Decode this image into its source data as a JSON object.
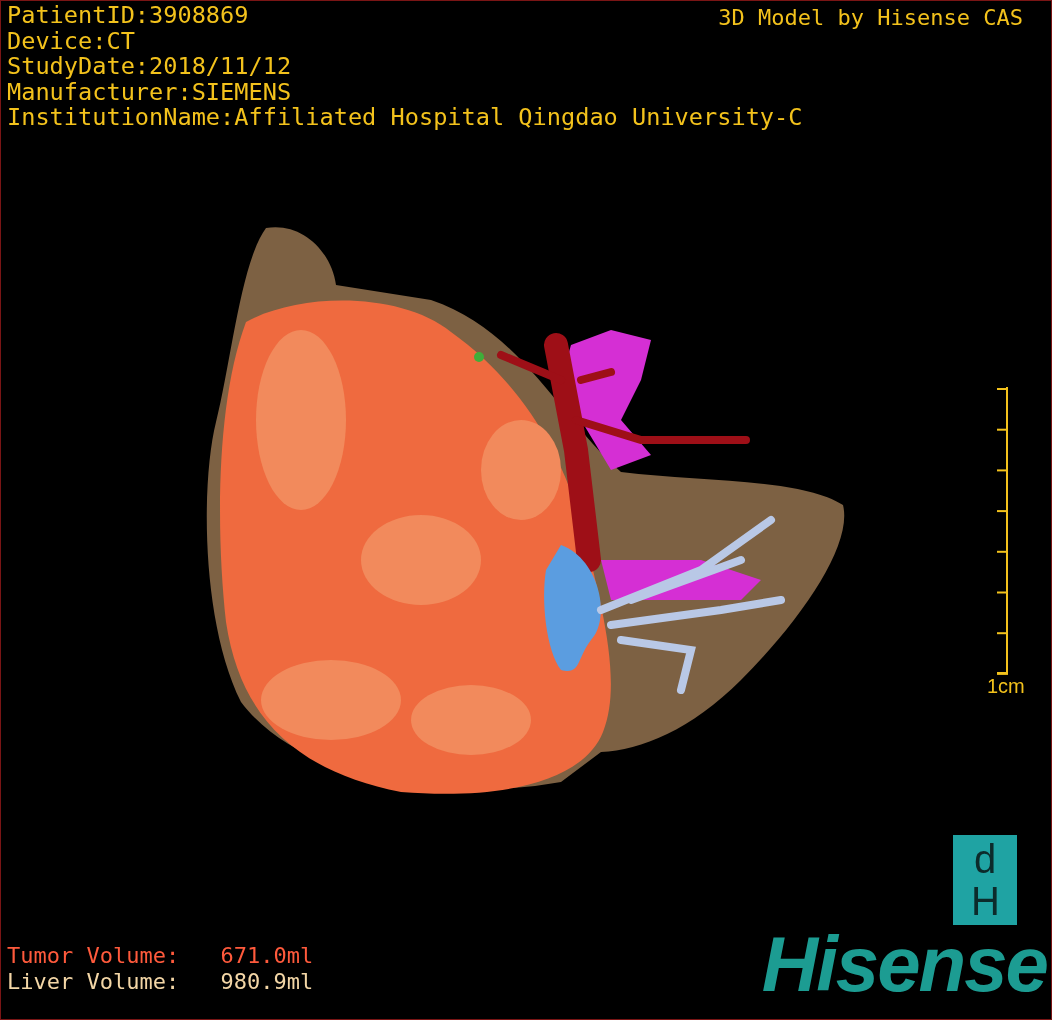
{
  "info_lines": [
    "PatientID:3908869",
    "Device:CT",
    "StudyDate:2018/11/12",
    "Manufacturer:SIEMENS",
    "InstitutionName:Affiliated Hospital Qingdao University-C"
  ],
  "title": "3D Model by Hisense CAS",
  "scale_label": "1cm",
  "volumes": [
    {
      "kind": "tumor",
      "label": "Tumor Volume:",
      "value": "671.0ml"
    },
    {
      "kind": "liver",
      "label": "Liver Volume:",
      "value": "980.9ml"
    }
  ],
  "logo": {
    "mark": "dH",
    "wordmark": "Hisense"
  }
}
